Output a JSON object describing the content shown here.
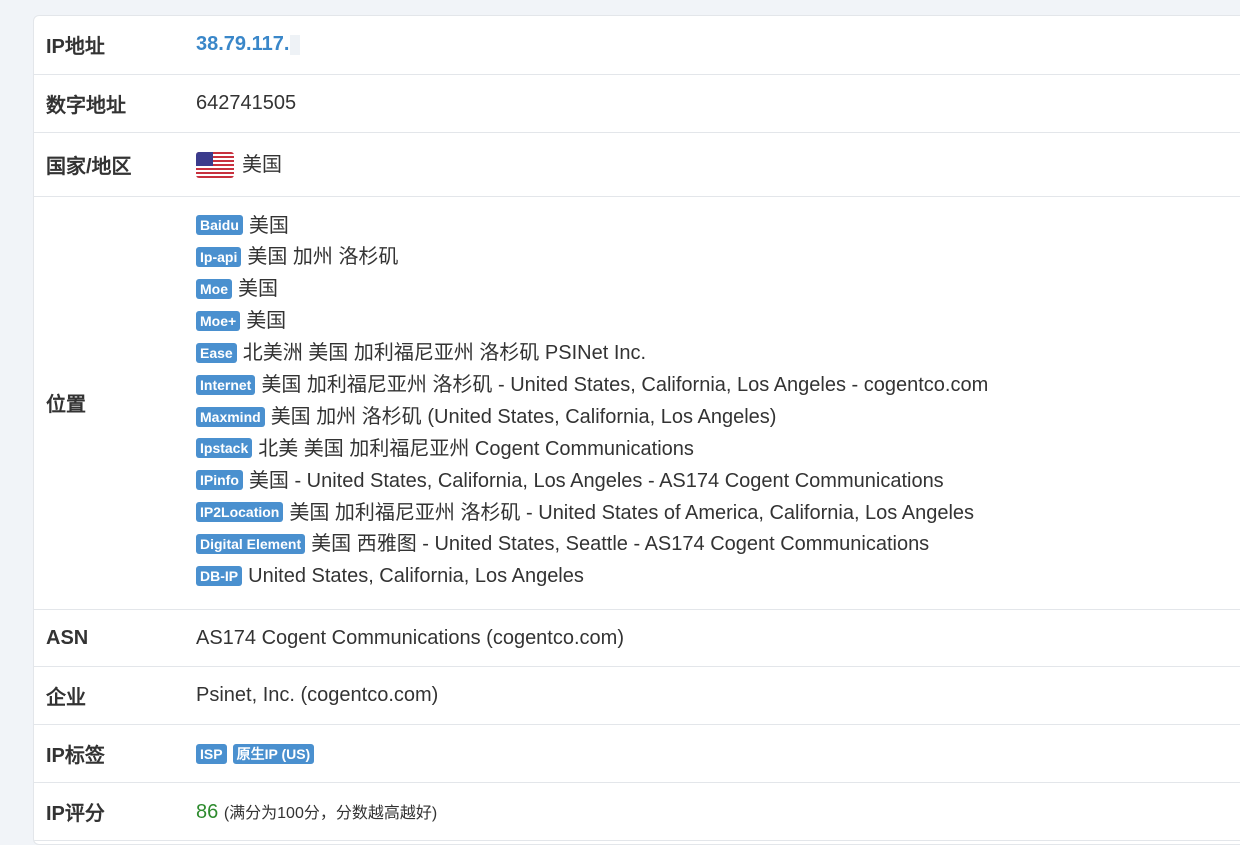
{
  "rows": {
    "ip": {
      "label": "IP地址",
      "value": "38.79.117."
    },
    "numeric": {
      "label": "数字地址",
      "value": "642741505"
    },
    "country": {
      "label": "国家/地区",
      "value": "美国",
      "flag_icon": "us-flag-icon"
    },
    "location": {
      "label": "位置",
      "sources": [
        {
          "source": "Baidu",
          "text": "美国"
        },
        {
          "source": "Ip-api",
          "text": "美国 加州 洛杉矶"
        },
        {
          "source": "Moe",
          "text": "美国"
        },
        {
          "source": "Moe+",
          "text": "美国"
        },
        {
          "source": "Ease",
          "text": "北美洲 美国 加利福尼亚州 洛杉矶 PSINet Inc."
        },
        {
          "source": "Internet",
          "text": "美国 加利福尼亚州 洛杉矶 - United States, California, Los Angeles - cogentco.com"
        },
        {
          "source": "Maxmind",
          "text": "美国 加州 洛杉矶 (United States, California, Los Angeles)"
        },
        {
          "source": "Ipstack",
          "text": "北美 美国 加利福尼亚州 Cogent Communications"
        },
        {
          "source": "IPinfo",
          "text": "美国 - United States, California, Los Angeles - AS174 Cogent Communications"
        },
        {
          "source": "IP2Location",
          "text": "美国 加利福尼亚州 洛杉矶 - United States of America, California, Los Angeles"
        },
        {
          "source": "Digital Element",
          "text": "美国 西雅图 - United States, Seattle - AS174 Cogent Communications"
        },
        {
          "source": "DB-IP",
          "text": "United States, California, Los Angeles"
        }
      ]
    },
    "asn": {
      "label": "ASN",
      "value": "AS174 Cogent Communications (cogentco.com)"
    },
    "company": {
      "label": "企业",
      "value": "Psinet, Inc. (cogentco.com)"
    },
    "tags": {
      "label": "IP标签",
      "items": [
        "ISP",
        "原生IP (US)"
      ]
    },
    "score": {
      "label": "IP评分",
      "value": "86",
      "note": "(满分为100分，分数越高越好)"
    }
  },
  "colors": {
    "link": "#3a87c9",
    "badge": "#4a90cf",
    "score": "#2e8b2e",
    "background": "#f1f4f8"
  }
}
